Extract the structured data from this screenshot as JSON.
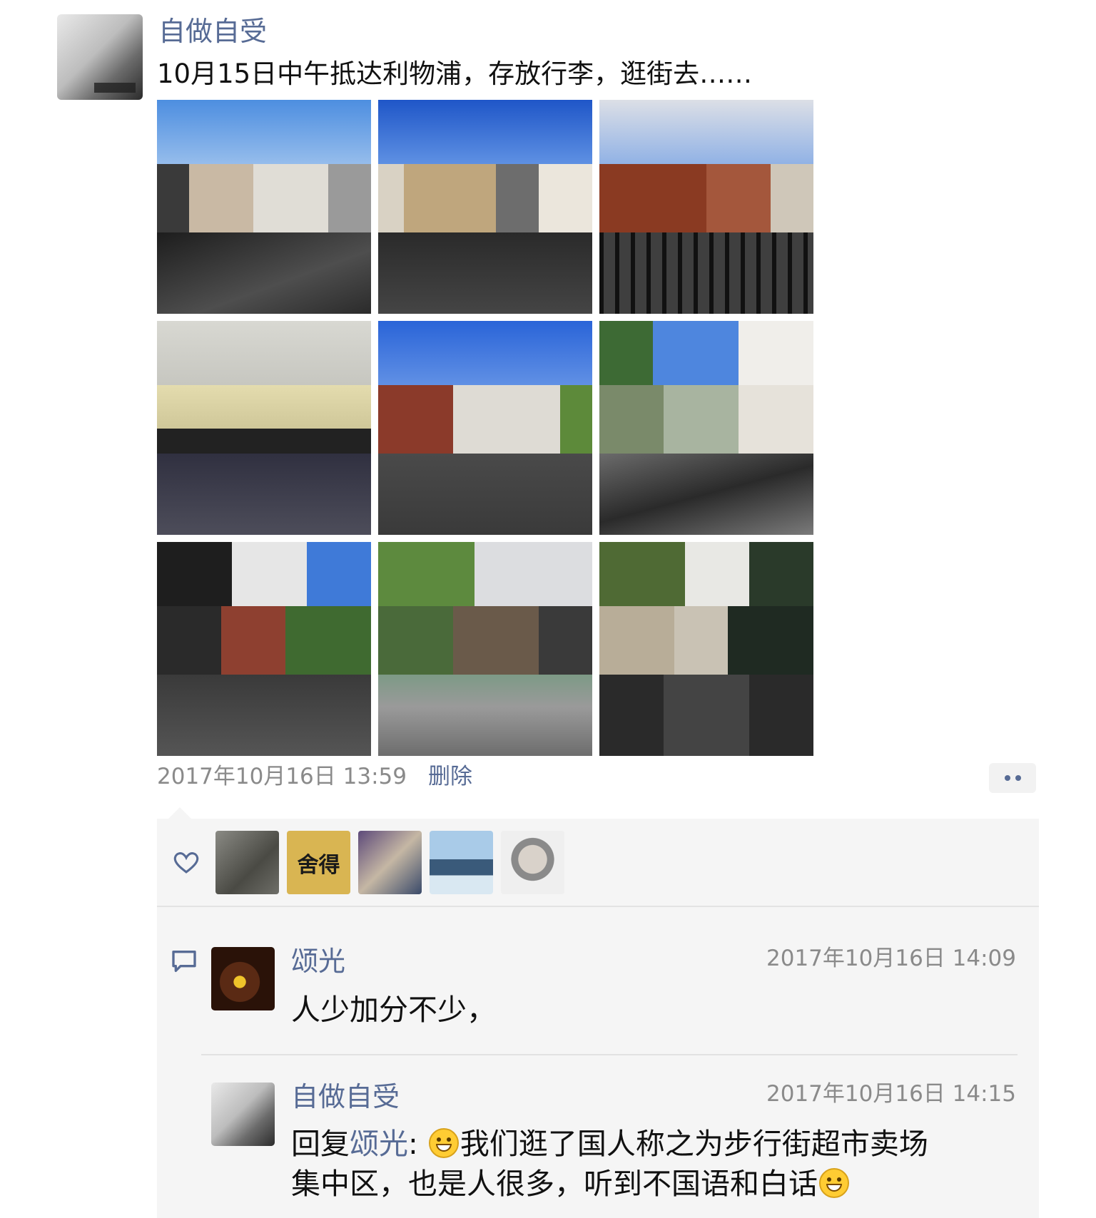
{
  "post": {
    "author": "自做自受",
    "text": "10月15日中午抵达利物浦，存放行李，逛街去……",
    "time": "2017年10月16日 13:59",
    "delete_label": "删除",
    "photos": [
      {
        "name": "street-corner-photo"
      },
      {
        "name": "ornate-building-photo"
      },
      {
        "name": "railing-street-photo"
      },
      {
        "name": "shopfront-photo"
      },
      {
        "name": "brick-building-photo"
      },
      {
        "name": "tower-plaza-photo"
      },
      {
        "name": "tudor-building-photo"
      },
      {
        "name": "bike-station-photo"
      },
      {
        "name": "tree-lined-street-photo"
      }
    ]
  },
  "likes": {
    "icon": "heart-icon",
    "avatars": [
      "liker-avatar-1",
      "liker-avatar-2",
      "liker-avatar-3",
      "liker-avatar-4",
      "liker-avatar-5"
    ],
    "avatar_2_text": "舍得"
  },
  "comments": [
    {
      "name": "颂光",
      "time": "2017年10月16日 14:09",
      "text": "人少加分不少，"
    },
    {
      "name": "自做自受",
      "time": "2017年10月16日 14:15",
      "reply_prefix": "回复",
      "reply_to": "颂光",
      "reply_colon": ":",
      "text_line1": "我们逛了国人称之为步行街超市卖场",
      "text_line2": "集中区，也是人很多，听到不国语和白话"
    }
  ],
  "colors": {
    "link": "#576b95",
    "meta": "#8a8a8a",
    "panel": "#f5f5f5"
  }
}
